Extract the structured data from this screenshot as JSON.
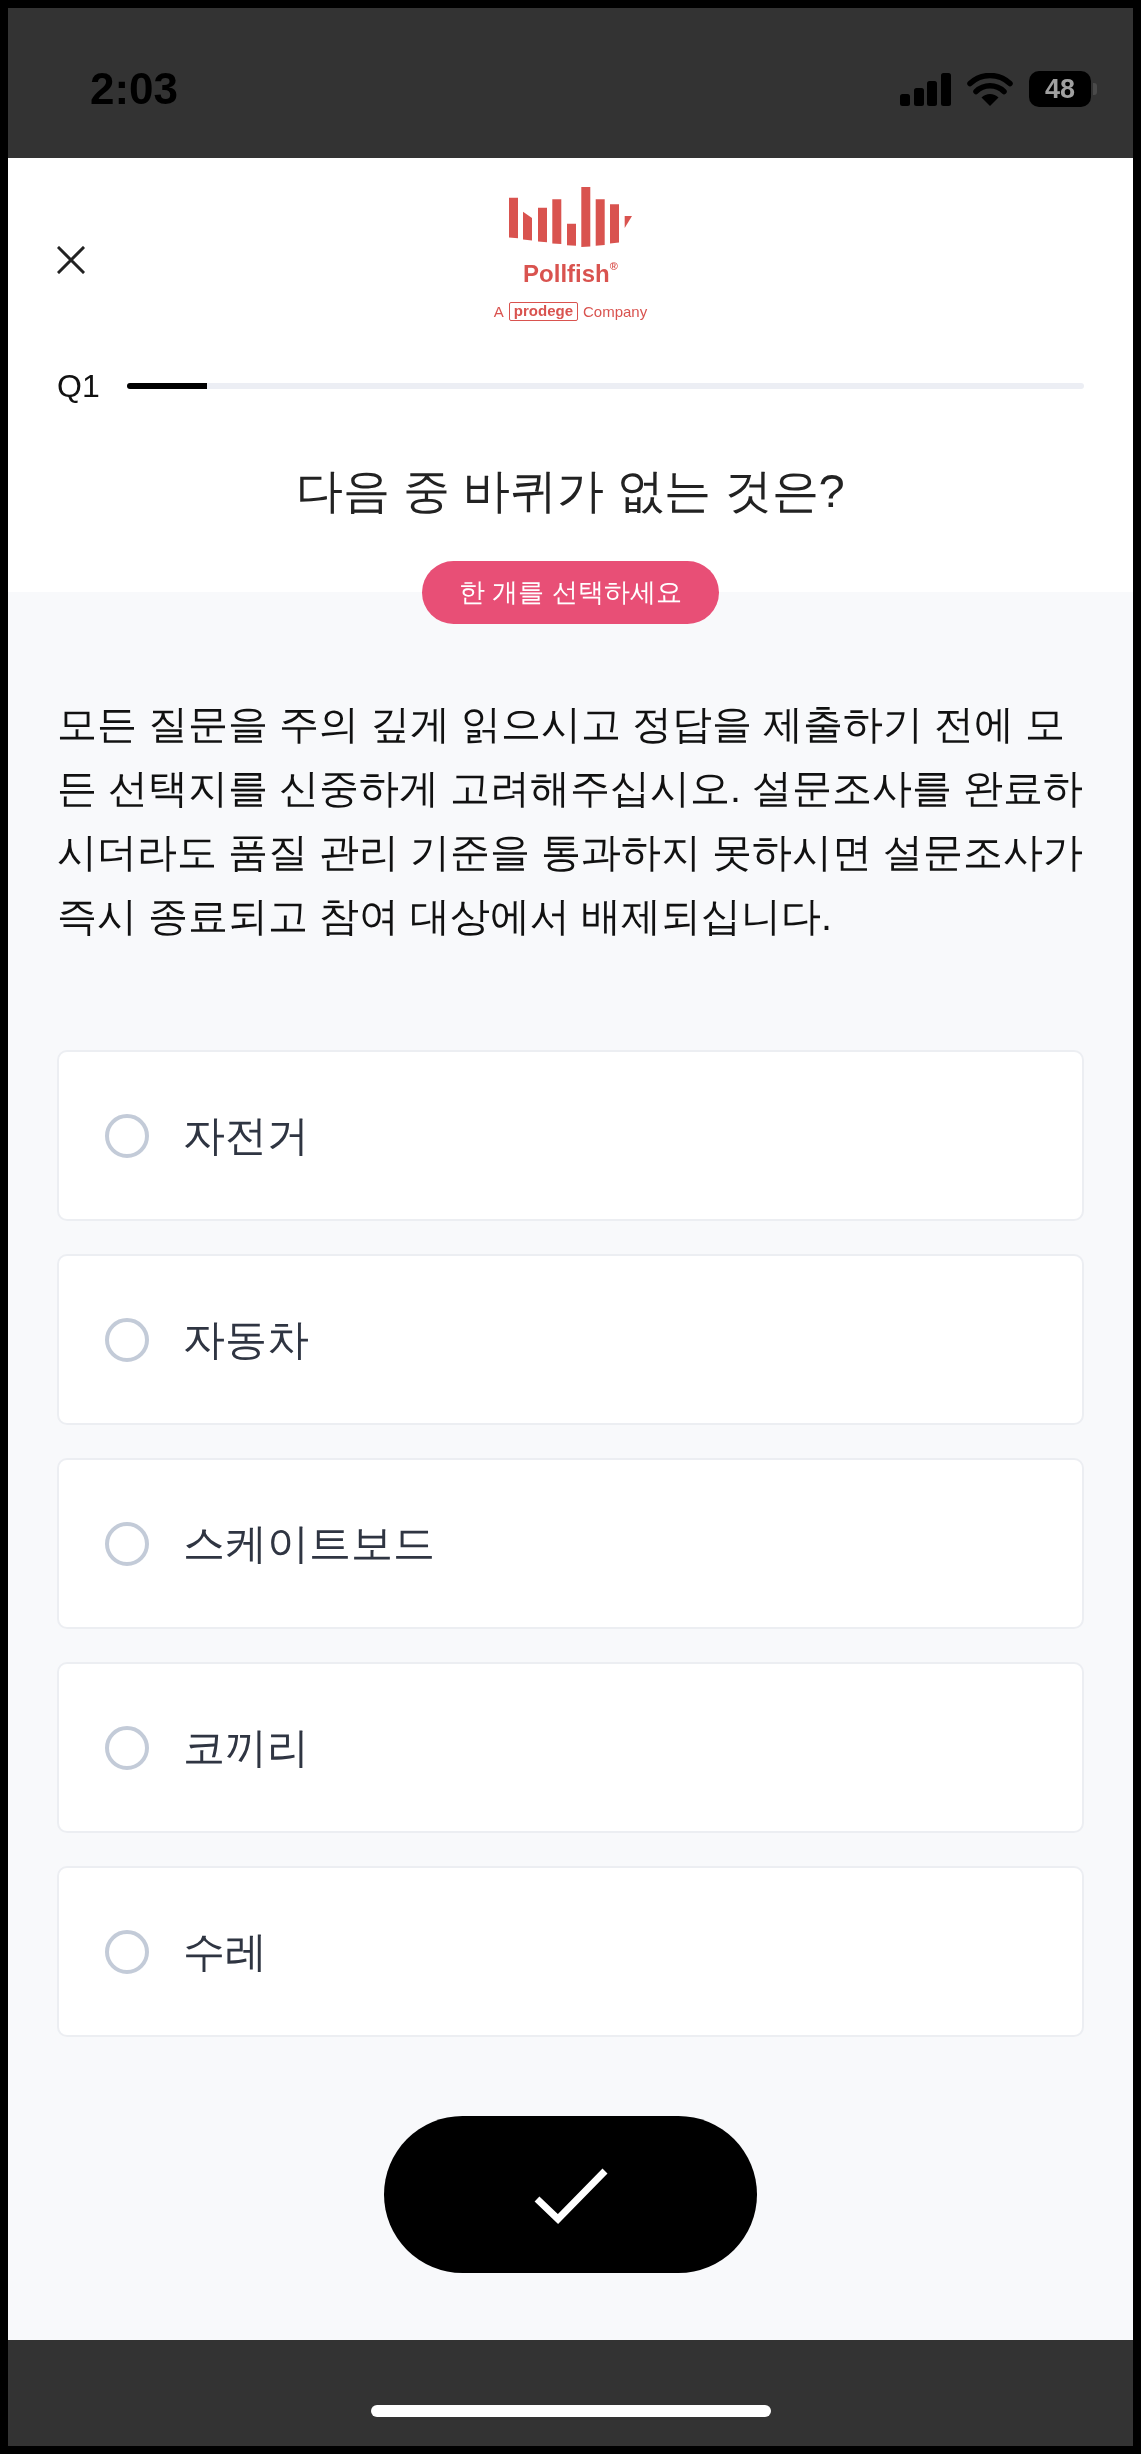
{
  "status_bar": {
    "time": "2:03",
    "battery": "48"
  },
  "header": {
    "brand": "Pollfish$^{®}$",
    "tagline": [
      {
        "kind": "text",
        "text": "A"
      },
      {
        "kind": "boxed",
        "text": "prodege"
      },
      {
        "kind": "text",
        "text": "Company"
      }
    ]
  },
  "progress": {
    "label": "Q1",
    "level": 0.084
  },
  "question": {
    "title": "다음 중 바퀴가 없는 것은?",
    "hint": "한 개를 선택하세요",
    "instructions": "모든 질문을 주의 깊게 읽으시고 정답을 제출하기 전에 모든 선택지를 신중하게 고려해주십시오. 설문조사를 완료하시더라도 품질 관리 기준을 통과하지 못하시면 설문조사가 즉시 종료되고 참여 대상에서 배제되십니다."
  },
  "options": [
    {
      "label": "자전거",
      "selected": false
    },
    {
      "label": "자동차",
      "selected": false
    },
    {
      "label": "스케이트보드",
      "selected": false
    },
    {
      "label": "코끼리",
      "selected": false
    },
    {
      "label": "수레",
      "selected": false
    }
  ]
}
